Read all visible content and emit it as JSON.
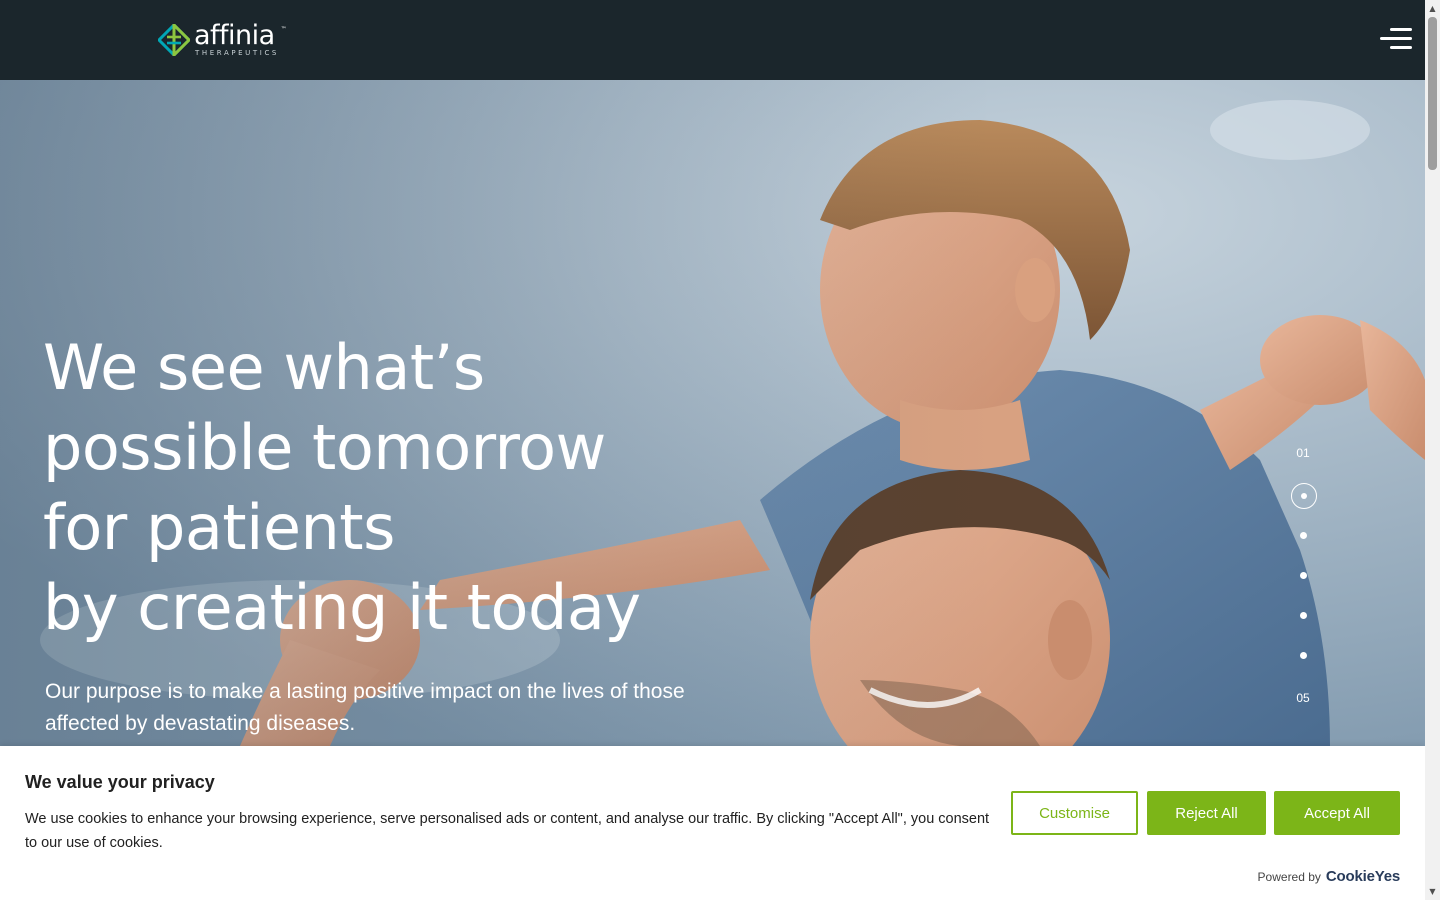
{
  "header": {
    "logo_word": "affinia",
    "logo_tm": "™",
    "logo_sub": "THERAPEUTICS",
    "menu_icon": "hamburger-menu-icon"
  },
  "hero": {
    "title_lines": [
      "We see what’s",
      "possible tomorrow",
      "for patients",
      "by creating it today"
    ],
    "subtitle": "Our purpose is to make a lasting positive impact on the lives of those affected by devastating diseases.",
    "pager": {
      "first": "01",
      "last": "05",
      "active_index": 1,
      "total_dots": 5
    }
  },
  "cookie_banner": {
    "title": "We value your privacy",
    "text": "We use cookies to enhance your browsing experience, serve personalised ads or content, and analyse our traffic. By clicking \"Accept All\", you consent to our use of cookies.",
    "customise_label": "Customise",
    "reject_label": "Reject All",
    "accept_label": "Accept All",
    "powered_by": "Powered by",
    "brand": "CookieYes"
  },
  "colors": {
    "header_bg": "#1b262c",
    "accent_green": "#7cb518",
    "logo_green": "#8dc63f",
    "logo_teal": "#00a7b5"
  }
}
